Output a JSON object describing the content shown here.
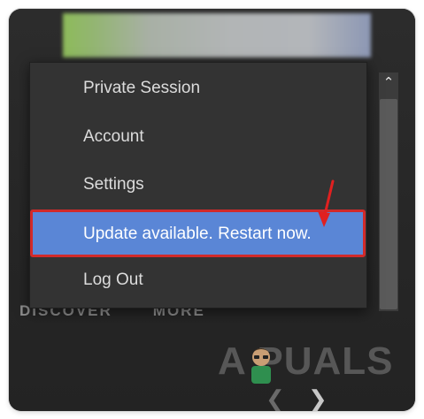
{
  "menu": {
    "items": [
      {
        "label": "Private Session"
      },
      {
        "label": "Account"
      },
      {
        "label": "Settings"
      },
      {
        "label": "Update available. Restart now."
      },
      {
        "label": "Log Out"
      }
    ]
  },
  "nav": {
    "discover": "DISCOVER",
    "more": "MORE"
  },
  "watermark": {
    "text": "A PUALS"
  },
  "icons": {
    "scroll_up": "chevron-up-icon",
    "prev": "chevron-left-icon",
    "next": "chevron-right-icon",
    "annotation": "red-arrow-icon"
  },
  "colors": {
    "menu_bg": "#333333",
    "highlight_bg": "#5a86d6",
    "highlight_border": "#d12a2a",
    "arrow": "#e02020"
  }
}
